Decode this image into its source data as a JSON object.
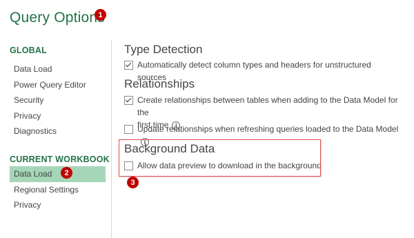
{
  "dialog": {
    "title": "Query Options"
  },
  "badges": {
    "b1": "1",
    "b2": "2",
    "b3": "3"
  },
  "sidebar": {
    "global_header": "GLOBAL",
    "global_items": [
      {
        "label": "Data Load"
      },
      {
        "label": "Power Query Editor"
      },
      {
        "label": "Security"
      },
      {
        "label": "Privacy"
      },
      {
        "label": "Diagnostics"
      }
    ],
    "current_header": "CURRENT WORKBOOK",
    "current_items": [
      {
        "label": "Data Load",
        "selected": true
      },
      {
        "label": "Regional Settings"
      },
      {
        "label": "Privacy"
      }
    ]
  },
  "content": {
    "type_detection": {
      "heading": "Type Detection",
      "option": {
        "label": "Automatically detect column types and headers for unstructured sources",
        "checked": true
      }
    },
    "relationships": {
      "heading": "Relationships",
      "option1": {
        "label_line1": "Create relationships between tables when adding to the Data Model for the",
        "label_line2": "first time",
        "checked": true
      },
      "option2": {
        "label": "Update relationships when refreshing queries loaded to the Data Model",
        "checked": false
      }
    },
    "background_data": {
      "heading": "Background Data",
      "option": {
        "label": "Allow data preview to download in the background",
        "checked": false
      }
    }
  },
  "colors": {
    "accent": "#217346",
    "selected_bg": "#a6d6b8",
    "badge": "#c00000",
    "highlight": "#e04848"
  },
  "icons": {
    "info": "info-icon"
  }
}
